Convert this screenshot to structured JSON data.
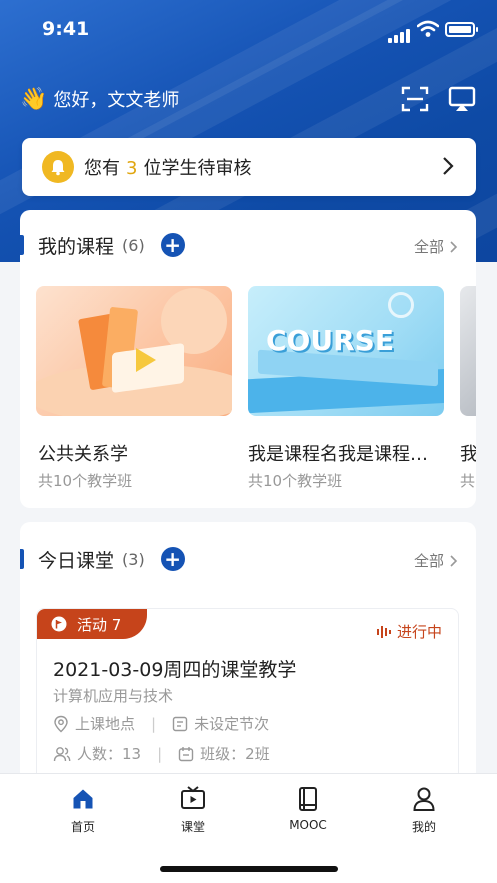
{
  "status": {
    "time": "9:41"
  },
  "header": {
    "greeting": "您好，文文老师",
    "scan_icon": "scan-icon",
    "cast_icon": "cast-icon"
  },
  "notice": {
    "prefix": "您有",
    "count": "3",
    "suffix": "位学生待审核"
  },
  "courses": {
    "title": "我的课程",
    "count": "(6)",
    "all_label": "全部",
    "items": [
      {
        "name": "公共关系学",
        "sub": "共10个教学班"
      },
      {
        "name": "我是课程名我是课程…",
        "sub": "共10个教学班",
        "art_text": "COURSE"
      },
      {
        "name": "我",
        "sub": "共"
      }
    ]
  },
  "today": {
    "title": "今日课堂",
    "count": "(3)",
    "all_label": "全部",
    "lesson": {
      "tag": "活动 7",
      "status": "进行中",
      "title": "2021-03-09周四的课堂教学",
      "subject": "计算机应用与技术",
      "location": "上课地点",
      "period": "未设定节次",
      "people": "人数：13",
      "class": "班级：2班"
    }
  },
  "tabbar": {
    "items": [
      {
        "label": "首页",
        "icon": "home-icon"
      },
      {
        "label": "课堂",
        "icon": "classroom-tv-icon"
      },
      {
        "label": "MOOC",
        "icon": "book-icon"
      },
      {
        "label": "我的",
        "icon": "profile-icon"
      }
    ]
  },
  "colors": {
    "primary": "#1553b4",
    "accent_orange": "#c6441b",
    "notice_gold": "#e0a610"
  }
}
